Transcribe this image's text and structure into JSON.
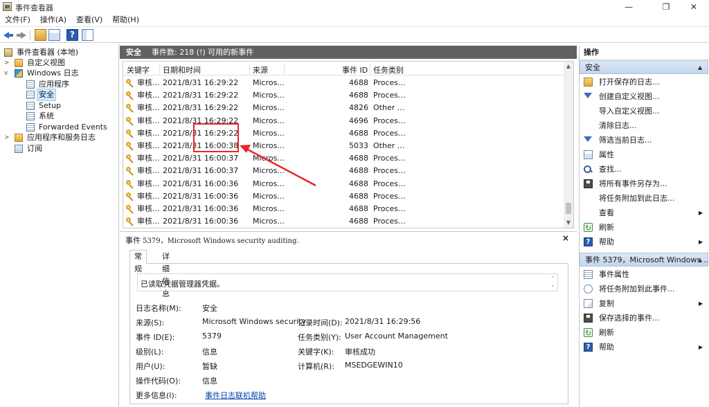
{
  "window": {
    "title": "事件查看器",
    "controls": {
      "minimize": "—",
      "maximize": "❐",
      "close": "✕"
    }
  },
  "menu": {
    "file": "文件(F)",
    "action": "操作(A)",
    "view": "查看(V)",
    "help": "帮助(H)"
  },
  "toolbar": {
    "help_glyph": "?"
  },
  "tree": {
    "root": "事件查看器 (本地)",
    "custom_views": "自定义视图",
    "windows_logs": "Windows 日志",
    "application": "应用程序",
    "security": "安全",
    "setup": "Setup",
    "system": "系统",
    "forwarded": "Forwarded Events",
    "apps_services": "应用程序和服务日志",
    "subscriptions": "订阅"
  },
  "center": {
    "title": "安全",
    "event_count": "事件数: 218 (!) 可用的新事件"
  },
  "grid": {
    "columns": {
      "keywords": "关键字",
      "datetime": "日期和时间",
      "source": "来源",
      "event_id": "事件 ID",
      "task": "任务类别"
    },
    "rows": [
      {
        "kw": "审核...",
        "dt": "2021/8/31 16:29:22",
        "src": "Micros...",
        "id": "4688",
        "task": "Proces..."
      },
      {
        "kw": "审核...",
        "dt": "2021/8/31 16:29:22",
        "src": "Micros...",
        "id": "4688",
        "task": "Proces..."
      },
      {
        "kw": "审核...",
        "dt": "2021/8/31 16:29:22",
        "src": "Micros...",
        "id": "4826",
        "task": "Other ..."
      },
      {
        "kw": "审核...",
        "dt": "2021/8/31 16:29:22",
        "src": "Micros...",
        "id": "4696",
        "task": "Proces..."
      },
      {
        "kw": "审核...",
        "dt": "2021/8/31 16:29:22",
        "src": "Micros...",
        "id": "4688",
        "task": "Proces..."
      },
      {
        "kw": "审核...",
        "dt": "2021/8/31 16:00:38",
        "src": "Micros...",
        "id": "5033",
        "task": "Other ..."
      },
      {
        "kw": "审核...",
        "dt": "2021/8/31 16:00:37",
        "src": "Micros...",
        "id": "4688",
        "task": "Proces..."
      },
      {
        "kw": "审核...",
        "dt": "2021/8/31 16:00:37",
        "src": "Micros...",
        "id": "4688",
        "task": "Proces..."
      },
      {
        "kw": "审核...",
        "dt": "2021/8/31 16:00:36",
        "src": "Micros...",
        "id": "4688",
        "task": "Proces..."
      },
      {
        "kw": "审核...",
        "dt": "2021/8/31 16:00:36",
        "src": "Micros...",
        "id": "4688",
        "task": "Proces..."
      },
      {
        "kw": "审核...",
        "dt": "2021/8/31 16:00:36",
        "src": "Micros...",
        "id": "4688",
        "task": "Proces..."
      },
      {
        "kw": "审核...",
        "dt": "2021/8/31 16:00:36",
        "src": "Micros...",
        "id": "4688",
        "task": "Proces..."
      }
    ]
  },
  "detail": {
    "title_prefix": "事件",
    "title_rest": " 5379，Microsoft Windows security auditing.",
    "close": "×",
    "tab_general": "常规",
    "tab_details": "详细信息",
    "description": "已读取凭据管理器凭据。",
    "fields": {
      "log_name_label": "日志名称(M):",
      "log_name": "安全",
      "source_label": "来源(S):",
      "source": "Microsoft Windows security",
      "logged_label": "记录时间(D):",
      "logged": "2021/8/31 16:29:56",
      "event_id_label": "事件 ID(E):",
      "event_id": "5379",
      "task_label": "任务类别(Y):",
      "task": "User Account Management",
      "level_label": "级别(L):",
      "level": "信息",
      "keywords_label": "关键字(K):",
      "keywords": "审核成功",
      "user_label": "用户(U):",
      "user": "暂缺",
      "computer_label": "计算机(R):",
      "computer": "MSEDGEWIN10",
      "opcode_label": "操作代码(O):",
      "opcode": "信息",
      "more_label": "更多信息(I):",
      "more_link": "事件日志联机帮助"
    }
  },
  "actions": {
    "header": "操作",
    "section1": "安全",
    "items1": {
      "open_saved": "打开保存的日志...",
      "create_view": "创建自定义视图...",
      "import_view": "导入自定义视图...",
      "clear_log": "清除日志...",
      "filter": "筛选当前日志...",
      "properties": "属性",
      "find": "查找...",
      "save_all": "将所有事件另存为...",
      "attach_log": "将任务附加到此日志...",
      "view": "查看",
      "refresh": "刷新",
      "help": "帮助"
    },
    "section2": "事件 5379，Microsoft Windows ...",
    "items2": {
      "event_props": "事件属性",
      "attach_event": "将任务附加到此事件...",
      "copy": "复制",
      "save_selected": "保存选择的事件...",
      "refresh": "刷新",
      "help": "帮助"
    }
  },
  "colors": {
    "annotation": "#e8242c",
    "header_bg": "#616161",
    "section_bg": "#c4d6ec"
  }
}
